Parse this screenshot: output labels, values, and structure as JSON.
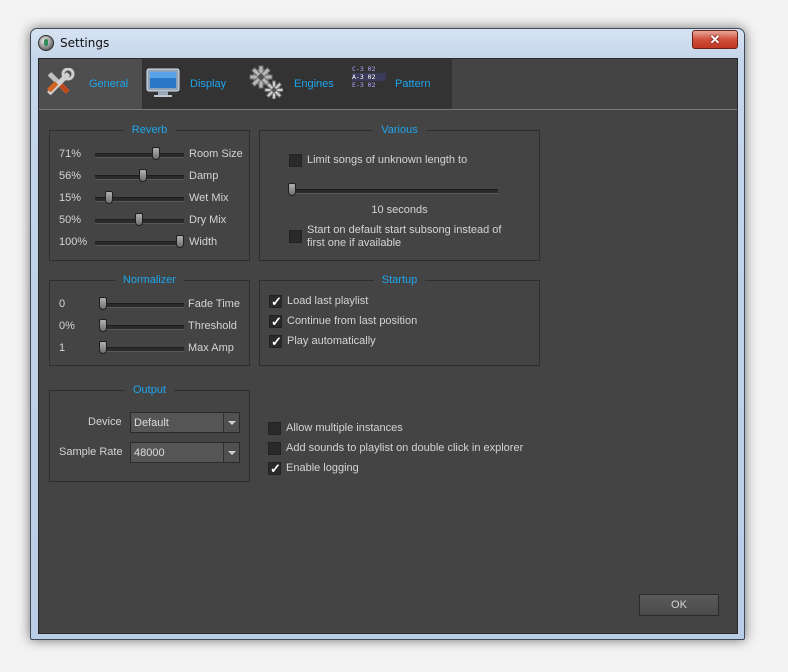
{
  "window": {
    "title": "Settings",
    "close_glyph": "✕"
  },
  "tabs": [
    {
      "label": "General",
      "icon": "tools-icon"
    },
    {
      "label": "Display",
      "icon": "monitor-icon"
    },
    {
      "label": "Engines",
      "icon": "gears-icon"
    },
    {
      "label": "Pattern",
      "icon": "pattern-icon"
    }
  ],
  "pattern_icon_lines": [
    "C-3 02",
    "A-3 02",
    "E-3 02"
  ],
  "reverb": {
    "title": "Reverb",
    "rows": [
      {
        "value": "71%",
        "label": "Room Size",
        "level": 0.71
      },
      {
        "value": "56%",
        "label": "Damp",
        "level": 0.56
      },
      {
        "value": "15%",
        "label": "Wet Mix",
        "level": 0.15
      },
      {
        "value": "50%",
        "label": "Dry Mix",
        "level": 0.5
      },
      {
        "value": "100%",
        "label": "Width",
        "level": 1.0
      }
    ]
  },
  "normalizer": {
    "title": "Normalizer",
    "rows": [
      {
        "value": "0",
        "label": "Fade Time",
        "level": 0
      },
      {
        "value": "0%",
        "label": "Threshold",
        "level": 0
      },
      {
        "value": "1",
        "label": "Max Amp",
        "level": 0
      }
    ]
  },
  "output": {
    "title": "Output",
    "device_label": "Device",
    "device_value": "Default",
    "rate_label": "Sample Rate",
    "rate_value": "48000"
  },
  "various": {
    "title": "Various",
    "limit_label": "Limit songs of unknown length to",
    "limit_checked": false,
    "seconds_value": "10 seconds",
    "seconds_level": 0,
    "subsong_line1": "Start on default start subsong instead of",
    "subsong_line2": "first one if available",
    "subsong_checked": false
  },
  "startup": {
    "title": "Startup",
    "items": [
      {
        "label": "Load last playlist",
        "checked": true
      },
      {
        "label": "Continue from last position",
        "checked": true
      },
      {
        "label": "Play automatically",
        "checked": true
      }
    ]
  },
  "misc": [
    {
      "label": "Allow multiple instances",
      "checked": false
    },
    {
      "label": "Add sounds to playlist on double click in explorer",
      "checked": false
    },
    {
      "label": "Enable logging",
      "checked": true
    }
  ],
  "ok_label": "OK",
  "colors": {
    "accent": "#1ea6ec",
    "background": "#444444",
    "tabbar": "#333333"
  }
}
